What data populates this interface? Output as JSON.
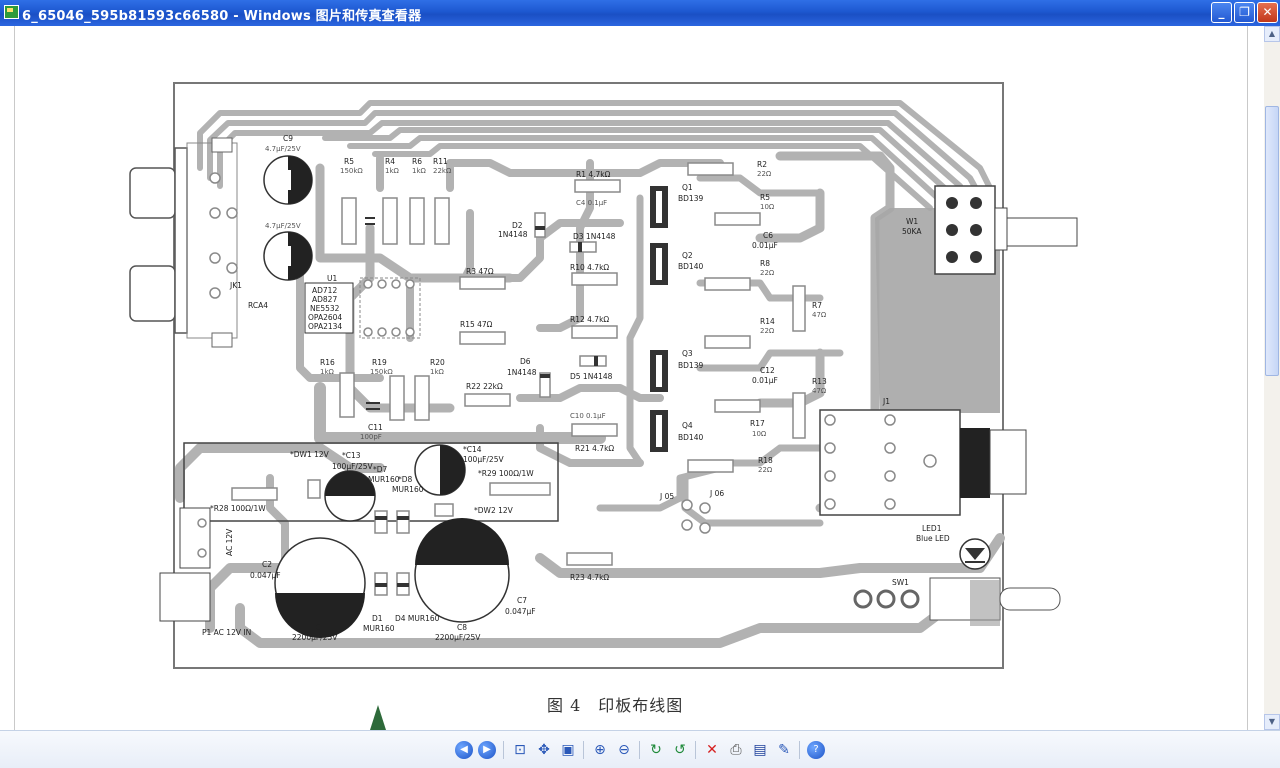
{
  "window": {
    "title": "6_65046_595b81593c66580 - Windows 图片和传真查看器",
    "buttons": {
      "minimize": "_",
      "restore": "❐",
      "close": "✕"
    }
  },
  "image": {
    "caption": "图 4　印板布线图",
    "labels": {
      "c9": "C9",
      "c9v": "4.7μF/25V",
      "c7b": "4.7μF/25V",
      "r5": "R5",
      "r5v": "150kΩ",
      "r4": "R4",
      "r4v": "1kΩ",
      "r6": "R6",
      "r6v": "1kΩ",
      "r11": "R11",
      "r11v": "22kΩ",
      "jk1": "JK1",
      "rca": "RCA4",
      "u1": "U1",
      "u1a": "AD712",
      "u1b": "AD827",
      "u1c": "NE5532",
      "u1d": "OPA2604",
      "u1e": "OPA2134",
      "r1": "R1 4.7kΩ",
      "c4": "C4 0.1μF",
      "d2": "D2",
      "d2v": "1N4148",
      "d3": "D3 1N4148",
      "q1": "Q1",
      "q1v": "BD139",
      "q2": "Q2",
      "q2v": "BD140",
      "r2": "R2",
      "r2v": "22Ω",
      "r5b": "R5",
      "r5bv": "10Ω",
      "c6": "C6",
      "c6v": "0.01μF",
      "r3": "R3 47Ω",
      "r10": "R10 4.7kΩ",
      "r8": "R8",
      "r8v": "22Ω",
      "r7": "R7",
      "r7v": "47Ω",
      "w1": "W1",
      "w1v": "50KA",
      "r15": "R15 47Ω",
      "r12": "R12 4.7kΩ",
      "r14": "R14",
      "r14v": "22Ω",
      "r16": "R16",
      "r16v": "1kΩ",
      "r19": "R19",
      "r19v": "150kΩ",
      "r20": "R20",
      "r20v": "1kΩ",
      "d6": "D6",
      "d6v": "1N4148",
      "d5": "D5 1N4148",
      "q3": "Q3",
      "q3v": "BD139",
      "c12": "C12",
      "c12v": "0.01μF",
      "r13": "R13",
      "r13v": "47Ω",
      "j1": "J1",
      "r22": "R22 22kΩ",
      "c11": "C11",
      "c11v": "100pF",
      "c10": "C10 0.1μF",
      "q4": "Q4",
      "q4v": "BD140",
      "r17": "R17",
      "r17v": "10Ω",
      "r21": "R21 4.7kΩ",
      "r18": "R18",
      "r18v": "22Ω",
      "dw1": "*DW1 12V",
      "c13": "*C13",
      "c13v": "100μF/25V",
      "c14": "*C14",
      "c14v": "100μF/25V",
      "d7": "*D7",
      "d7v": "MUR160",
      "d8": "*D8",
      "d8v": "MUR160",
      "r29": "*R29 100Ω/1W",
      "r28": "*R28 100Ω/1W",
      "dw2": "*DW2 12V",
      "j05": "J 05",
      "j06": "J 06",
      "led": "LED1",
      "ledv": "Blue LED",
      "c2": "C2",
      "c2v": "0.047μF",
      "ac12": "AC 12V",
      "c1": "C1",
      "c1v": "2200μF/25V",
      "c8": "C8",
      "c8v": "2200μF/25V",
      "d1": "D1",
      "d1v": "MUR160",
      "d4": "D4 MUR160",
      "c7": "C7",
      "c7v": "0.047μF",
      "r23": "R23 4.7kΩ",
      "sw1": "SW1",
      "p1": "P1  AC 12V IN"
    }
  },
  "toolbar": {
    "icons": [
      "prev-image-icon",
      "next-image-icon",
      "best-fit-icon",
      "actual-size-icon",
      "slideshow-icon",
      "zoom-in-icon",
      "zoom-out-icon",
      "rotate-cw-icon",
      "rotate-ccw-icon",
      "delete-icon",
      "print-icon",
      "save-icon",
      "edit-icon",
      "help-icon"
    ]
  }
}
